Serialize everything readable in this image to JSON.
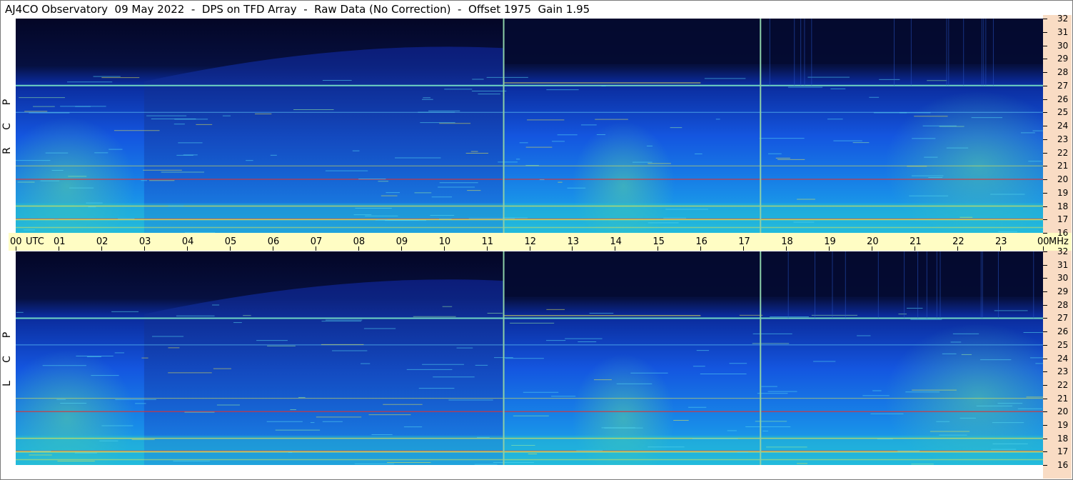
{
  "title": "AJ4CO Observatory  09 May 2022  -  DPS on TFD Array  -  Raw Data (No Correction)  -  Offset 1975  Gain 1.95",
  "time_axis": {
    "labels": [
      "00",
      "UTC",
      "01",
      "02",
      "03",
      "04",
      "05",
      "06",
      "07",
      "08",
      "09",
      "10",
      "11",
      "12",
      "13",
      "14",
      "15",
      "16",
      "17",
      "18",
      "19",
      "20",
      "21",
      "22",
      "23",
      "00",
      "MHz"
    ]
  },
  "freq_axis": {
    "top_labels": [
      "32",
      "31",
      "30",
      "29",
      "28",
      "27",
      "26",
      "25",
      "24",
      "23",
      "22",
      "21",
      "20",
      "19",
      "18",
      "17",
      "16"
    ],
    "bottom_labels": [
      "32",
      "31",
      "30",
      "29",
      "28",
      "27",
      "26",
      "25",
      "24",
      "23",
      "22",
      "21",
      "20",
      "19",
      "18",
      "17",
      "16"
    ]
  },
  "panels": [
    {
      "pol_letters": [
        "P",
        "C",
        "R"
      ]
    },
    {
      "pol_letters": [
        "P",
        "C",
        "L"
      ]
    }
  ],
  "colors": {
    "background_dark": "#040626",
    "spectral_blue": "#1450e6",
    "spectral_cyan": "#14b4f0",
    "spectral_green": "#5ad2a0",
    "rfi_yellow": "#e6e650",
    "rfi_red": "#e03030",
    "time_axis_bg": "#fffdc4",
    "freq_axis_bg": "#f9dcc4"
  },
  "chart_data": {
    "type": "heatmap",
    "title": "AJ4CO Observatory  09 May 2022  -  DPS on TFD Array  -  Raw Data (No Correction)  -  Offset 1975  Gain 1.95",
    "x_unit": "UTC",
    "x_range": [
      0,
      24
    ],
    "x_ticks": [
      0,
      1,
      2,
      3,
      4,
      5,
      6,
      7,
      8,
      9,
      10,
      11,
      12,
      13,
      14,
      15,
      16,
      17,
      18,
      19,
      20,
      21,
      22,
      23,
      24
    ],
    "y_unit": "MHz",
    "y_range": [
      16,
      32
    ],
    "y_ticks": [
      16,
      17,
      18,
      19,
      20,
      21,
      22,
      23,
      24,
      25,
      26,
      27,
      28,
      29,
      30,
      31,
      32
    ],
    "panels": [
      "RCP",
      "LCP"
    ],
    "vertical_markers_utc": [
      11.4,
      17.4
    ],
    "persistent_interference_mhz": [
      27,
      25,
      21,
      20,
      18,
      17
    ]
  }
}
